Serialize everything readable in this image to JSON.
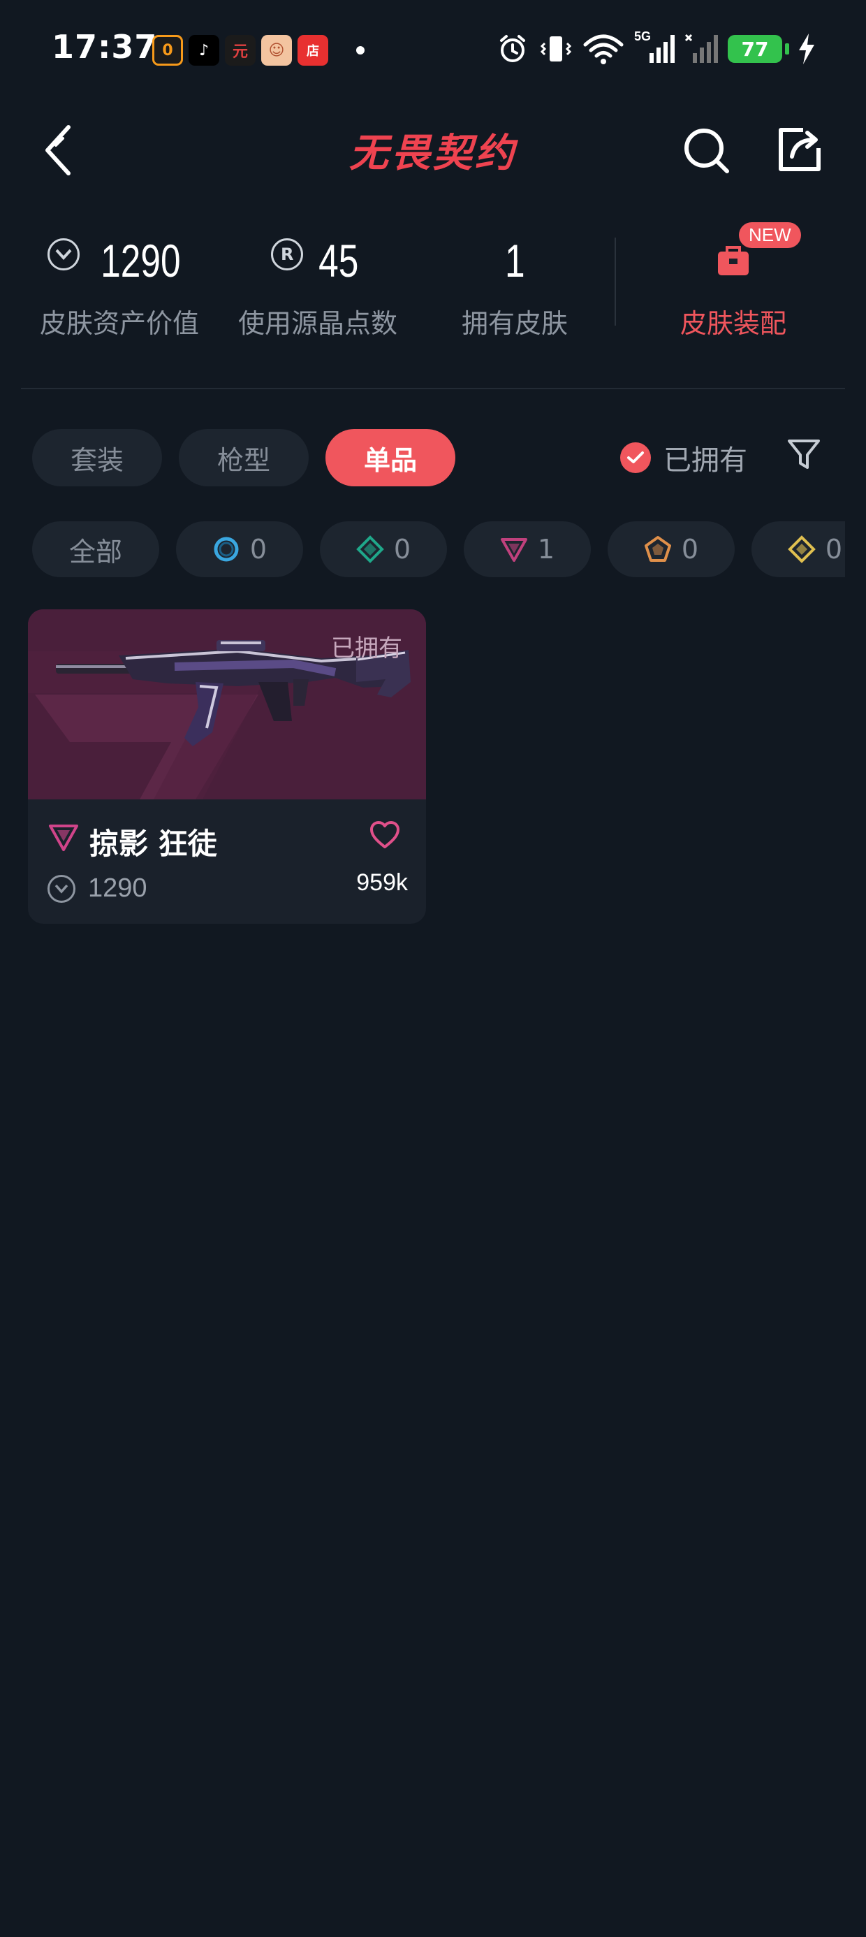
{
  "status_bar": {
    "time": "17:37",
    "notifications": [
      {
        "icon": "app-notification-icon",
        "color": "#f79a1a",
        "glyph": "0"
      },
      {
        "icon": "tiktok-icon",
        "color": "#ffffff",
        "glyph": "♪"
      },
      {
        "icon": "app-notification-icon",
        "color": "#e04040",
        "glyph": "元"
      },
      {
        "icon": "game-notification-icon",
        "color": "#f0a070",
        "glyph": "☺"
      },
      {
        "icon": "shop-notification-icon",
        "color": "#e83030",
        "glyph": "店"
      }
    ],
    "battery": "77",
    "network": "5G"
  },
  "header": {
    "logo_text": "无畏契约"
  },
  "stats": [
    {
      "value": "1290",
      "label": "皮肤资产价值",
      "icon": "vp-icon",
      "icon_glyph": "✓"
    },
    {
      "value": "45",
      "label": "使用源晶点数",
      "icon": "radianite-icon",
      "icon_glyph": "R"
    },
    {
      "value": "1",
      "label": "拥有皮肤",
      "icon": "",
      "icon_glyph": ""
    }
  ],
  "loadout": {
    "label": "皮肤装配",
    "badge": "NEW"
  },
  "tabs": [
    {
      "label": "套装",
      "active": false
    },
    {
      "label": "枪型",
      "active": false
    },
    {
      "label": "单品",
      "active": true
    }
  ],
  "owned_filter": {
    "label": "已拥有",
    "checked": true
  },
  "tier_chips": [
    {
      "label": "全部",
      "icon": "",
      "color": ""
    },
    {
      "label": "0",
      "icon": "select-tier-icon",
      "color": "#3aa7e0"
    },
    {
      "label": "0",
      "icon": "deluxe-tier-icon",
      "color": "#1fa88a"
    },
    {
      "label": "1",
      "icon": "premium-tier-icon",
      "color": "#c0417d"
    },
    {
      "label": "0",
      "icon": "exclusive-tier-icon",
      "color": "#e0904a"
    },
    {
      "label": "0",
      "icon": "ultra-tier-icon",
      "color": "#e0c050"
    }
  ],
  "skins": [
    {
      "owned_tag": "已拥有",
      "name": "掠影 狂徒",
      "price": "1290",
      "likes": "959k",
      "tier_icon": "premium-tier-icon",
      "tier_color": "#d0448a",
      "art_bg": "#4a1f3b"
    }
  ],
  "colors": {
    "accent": "#f0565d",
    "background": "#111821",
    "surface": "#1d252f"
  }
}
